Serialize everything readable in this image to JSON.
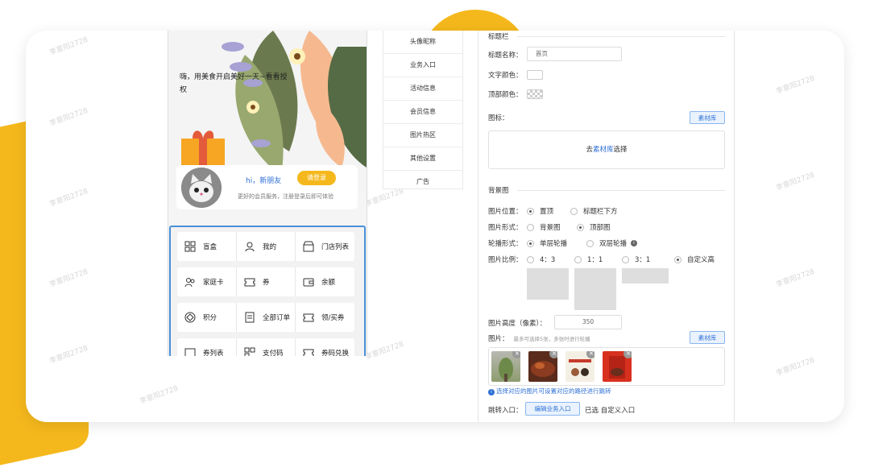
{
  "watermark_text": "李意阳2728",
  "phone": {
    "hero_text": "嗨，用美食开启美好一天~看看授权",
    "member": {
      "greeting": "hi，新朋友",
      "login_button": "请登录",
      "subtitle": "更好的会员服务，注册登录后即可体验"
    },
    "grid": [
      [
        {
          "icon": "grid-icon",
          "label": "盲盒"
        },
        {
          "icon": "user-icon",
          "label": "我的"
        },
        {
          "icon": "store-icon",
          "label": "门店列表"
        }
      ],
      [
        {
          "icon": "family-icon",
          "label": "家庭卡"
        },
        {
          "icon": "coupon-icon",
          "label": "券"
        },
        {
          "icon": "wallet-icon",
          "label": "余额"
        }
      ],
      [
        {
          "icon": "points-icon",
          "label": "积分"
        },
        {
          "icon": "order-icon",
          "label": "全部订单"
        },
        {
          "icon": "ticket-icon",
          "label": "领/买券"
        }
      ],
      [
        {
          "icon": "list-icon",
          "label": "券列表"
        },
        {
          "icon": "qrcode-icon",
          "label": "支付码"
        },
        {
          "icon": "exchange-icon",
          "label": "券码兑换"
        }
      ]
    ]
  },
  "nav": [
    "头像昵称",
    "业务入口",
    "活动信息",
    "会员信息",
    "图片热区",
    "其他设置",
    "广告"
  ],
  "panel": {
    "title_section": "标题栏",
    "title_name_label": "标题名称：",
    "title_name_value": "首页",
    "text_color_label": "文字颜色：",
    "top_color_label": "顶部颜色：",
    "icon_label": "图标：",
    "library_button": "素材库",
    "choose_prefix": "去",
    "choose_link": "素材库",
    "choose_suffix": "选择",
    "bg_section": "背景图",
    "img_position_label": "图片位置：",
    "img_position_options": [
      "置顶",
      "标题栏下方"
    ],
    "img_form_label": "图片形式：",
    "img_form_options": [
      "背景图",
      "顶部图"
    ],
    "carousel_label": "轮播形式：",
    "carousel_options": [
      "单层轮播",
      "双层轮播"
    ],
    "ratio_label": "图片比例：",
    "ratio_options": [
      "4：3",
      "1：1",
      "3：1",
      "自定义高"
    ],
    "height_label": "图片高度（像素）：",
    "height_value": "350",
    "images_label": "图片：",
    "images_hint": "最多可选择5张，多张时进行轮播",
    "info_text": "选择对应的图片可设置对应的路径进行跳转",
    "jump_label": "跳转入口：",
    "jump_button": "编辑业务入口",
    "jump_selected": "已选 自定义入口"
  },
  "colors": {
    "accent": "#f5b81c",
    "link": "#2d6fd6",
    "selection": "#4a90d9"
  }
}
